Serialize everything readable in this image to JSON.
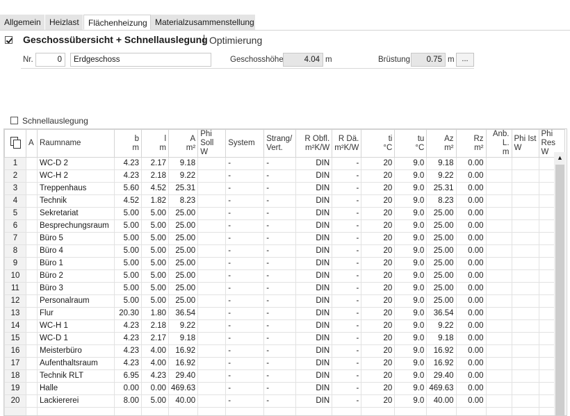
{
  "tabs": [
    {
      "label": "Allgemein"
    },
    {
      "label": "Heizlast"
    },
    {
      "label": "Flächenheizung"
    },
    {
      "label": "Materialzusammenstellung"
    }
  ],
  "header": {
    "title": "Geschossübersicht + Schnellauslegung",
    "optimierung": "Optimierung",
    "title_checked": true
  },
  "floor": {
    "nr_label": "Nr.",
    "nr_value": "0",
    "name_value": "Erdgeschoss",
    "height_label": "Geschosshöhe",
    "height_value": "4.04",
    "height_unit": "m",
    "bruestung_label": "Brüstung",
    "bruestung_value": "0.75",
    "bruestung_unit": "m",
    "more_button": "..."
  },
  "schnell": {
    "label": "Schnellauslegung",
    "checked": false
  },
  "table": {
    "headers": {
      "a": "A",
      "raumname": "Raumname",
      "b": [
        "b",
        "m"
      ],
      "l": [
        "l",
        "m"
      ],
      "area": [
        "A",
        "m²"
      ],
      "phisoll": [
        "Phi Soll",
        "W"
      ],
      "system": "System",
      "strang": [
        "Strang/",
        "Vert."
      ],
      "robfl": [
        "R Obfl.",
        "m²K/W"
      ],
      "rdae": [
        "R Dä.",
        "m²K/W"
      ],
      "ti": [
        "ti",
        "°C"
      ],
      "tu": [
        "tu",
        "°C"
      ],
      "az": [
        "Az",
        "m²"
      ],
      "rz": [
        "Rz",
        "m²"
      ],
      "anb": [
        "Anb. L.",
        "m"
      ],
      "phiist": [
        "Phi Ist",
        "W"
      ],
      "phires": [
        "Phi Res",
        "W"
      ]
    },
    "rows": [
      {
        "n": "1",
        "name": "WC-D 2",
        "b": "4.23",
        "l": "2.17",
        "a": "9.18",
        "sys": "-",
        "str": "-",
        "robfl": "DIN",
        "rdae": "-",
        "ti": "20",
        "tu": "9.0",
        "az": "9.18",
        "rz": "0.00"
      },
      {
        "n": "2",
        "name": "WC-H 2",
        "b": "4.23",
        "l": "2.18",
        "a": "9.22",
        "sys": "-",
        "str": "-",
        "robfl": "DIN",
        "rdae": "-",
        "ti": "20",
        "tu": "9.0",
        "az": "9.22",
        "rz": "0.00"
      },
      {
        "n": "3",
        "name": "Treppenhaus",
        "b": "5.60",
        "l": "4.52",
        "a": "25.31",
        "sys": "-",
        "str": "-",
        "robfl": "DIN",
        "rdae": "-",
        "ti": "20",
        "tu": "9.0",
        "az": "25.31",
        "rz": "0.00"
      },
      {
        "n": "4",
        "name": "Technik",
        "b": "4.52",
        "l": "1.82",
        "a": "8.23",
        "sys": "-",
        "str": "-",
        "robfl": "DIN",
        "rdae": "-",
        "ti": "20",
        "tu": "9.0",
        "az": "8.23",
        "rz": "0.00"
      },
      {
        "n": "5",
        "name": "Sekretariat",
        "b": "5.00",
        "l": "5.00",
        "a": "25.00",
        "sys": "-",
        "str": "-",
        "robfl": "DIN",
        "rdae": "-",
        "ti": "20",
        "tu": "9.0",
        "az": "25.00",
        "rz": "0.00"
      },
      {
        "n": "6",
        "name": "Besprechungsraum",
        "b": "5.00",
        "l": "5.00",
        "a": "25.00",
        "sys": "-",
        "str": "-",
        "robfl": "DIN",
        "rdae": "-",
        "ti": "20",
        "tu": "9.0",
        "az": "25.00",
        "rz": "0.00"
      },
      {
        "n": "7",
        "name": "Büro 5",
        "b": "5.00",
        "l": "5.00",
        "a": "25.00",
        "sys": "-",
        "str": "-",
        "robfl": "DIN",
        "rdae": "-",
        "ti": "20",
        "tu": "9.0",
        "az": "25.00",
        "rz": "0.00"
      },
      {
        "n": "8",
        "name": "Büro 4",
        "b": "5.00",
        "l": "5.00",
        "a": "25.00",
        "sys": "-",
        "str": "-",
        "robfl": "DIN",
        "rdae": "-",
        "ti": "20",
        "tu": "9.0",
        "az": "25.00",
        "rz": "0.00"
      },
      {
        "n": "9",
        "name": "Büro 1",
        "b": "5.00",
        "l": "5.00",
        "a": "25.00",
        "sys": "-",
        "str": "-",
        "robfl": "DIN",
        "rdae": "-",
        "ti": "20",
        "tu": "9.0",
        "az": "25.00",
        "rz": "0.00"
      },
      {
        "n": "10",
        "name": "Büro 2",
        "b": "5.00",
        "l": "5.00",
        "a": "25.00",
        "sys": "-",
        "str": "-",
        "robfl": "DIN",
        "rdae": "-",
        "ti": "20",
        "tu": "9.0",
        "az": "25.00",
        "rz": "0.00"
      },
      {
        "n": "11",
        "name": "Büro 3",
        "b": "5.00",
        "l": "5.00",
        "a": "25.00",
        "sys": "-",
        "str": "-",
        "robfl": "DIN",
        "rdae": "-",
        "ti": "20",
        "tu": "9.0",
        "az": "25.00",
        "rz": "0.00"
      },
      {
        "n": "12",
        "name": "Personalraum",
        "b": "5.00",
        "l": "5.00",
        "a": "25.00",
        "sys": "-",
        "str": "-",
        "robfl": "DIN",
        "rdae": "-",
        "ti": "20",
        "tu": "9.0",
        "az": "25.00",
        "rz": "0.00"
      },
      {
        "n": "13",
        "name": "Flur",
        "b": "20.30",
        "l": "1.80",
        "a": "36.54",
        "sys": "-",
        "str": "-",
        "robfl": "DIN",
        "rdae": "-",
        "ti": "20",
        "tu": "9.0",
        "az": "36.54",
        "rz": "0.00"
      },
      {
        "n": "14",
        "name": "WC-H 1",
        "b": "4.23",
        "l": "2.18",
        "a": "9.22",
        "sys": "-",
        "str": "-",
        "robfl": "DIN",
        "rdae": "-",
        "ti": "20",
        "tu": "9.0",
        "az": "9.22",
        "rz": "0.00"
      },
      {
        "n": "15",
        "name": "WC-D 1",
        "b": "4.23",
        "l": "2.17",
        "a": "9.18",
        "sys": "-",
        "str": "-",
        "robfl": "DIN",
        "rdae": "-",
        "ti": "20",
        "tu": "9.0",
        "az": "9.18",
        "rz": "0.00"
      },
      {
        "n": "16",
        "name": "Meisterbüro",
        "b": "4.23",
        "l": "4.00",
        "a": "16.92",
        "sys": "-",
        "str": "-",
        "robfl": "DIN",
        "rdae": "-",
        "ti": "20",
        "tu": "9.0",
        "az": "16.92",
        "rz": "0.00"
      },
      {
        "n": "17",
        "name": "Aufenthaltsraum",
        "b": "4.23",
        "l": "4.00",
        "a": "16.92",
        "sys": "-",
        "str": "-",
        "robfl": "DIN",
        "rdae": "-",
        "ti": "20",
        "tu": "9.0",
        "az": "16.92",
        "rz": "0.00"
      },
      {
        "n": "18",
        "name": "Technik RLT",
        "b": "6.95",
        "l": "4.23",
        "a": "29.40",
        "sys": "-",
        "str": "-",
        "robfl": "DIN",
        "rdae": "-",
        "ti": "20",
        "tu": "9.0",
        "az": "29.40",
        "rz": "0.00"
      },
      {
        "n": "19",
        "name": "Halle",
        "b": "0.00",
        "l": "0.00",
        "a": "469.63",
        "sys": "-",
        "str": "-",
        "robfl": "DIN",
        "rdae": "-",
        "ti": "20",
        "tu": "9.0",
        "az": "469.63",
        "rz": "0.00"
      },
      {
        "n": "20",
        "name": "Lackiererei",
        "b": "8.00",
        "l": "5.00",
        "a": "40.00",
        "sys": "-",
        "str": "-",
        "robfl": "DIN",
        "rdae": "-",
        "ti": "20",
        "tu": "9.0",
        "az": "40.00",
        "rz": "0.00"
      }
    ]
  }
}
